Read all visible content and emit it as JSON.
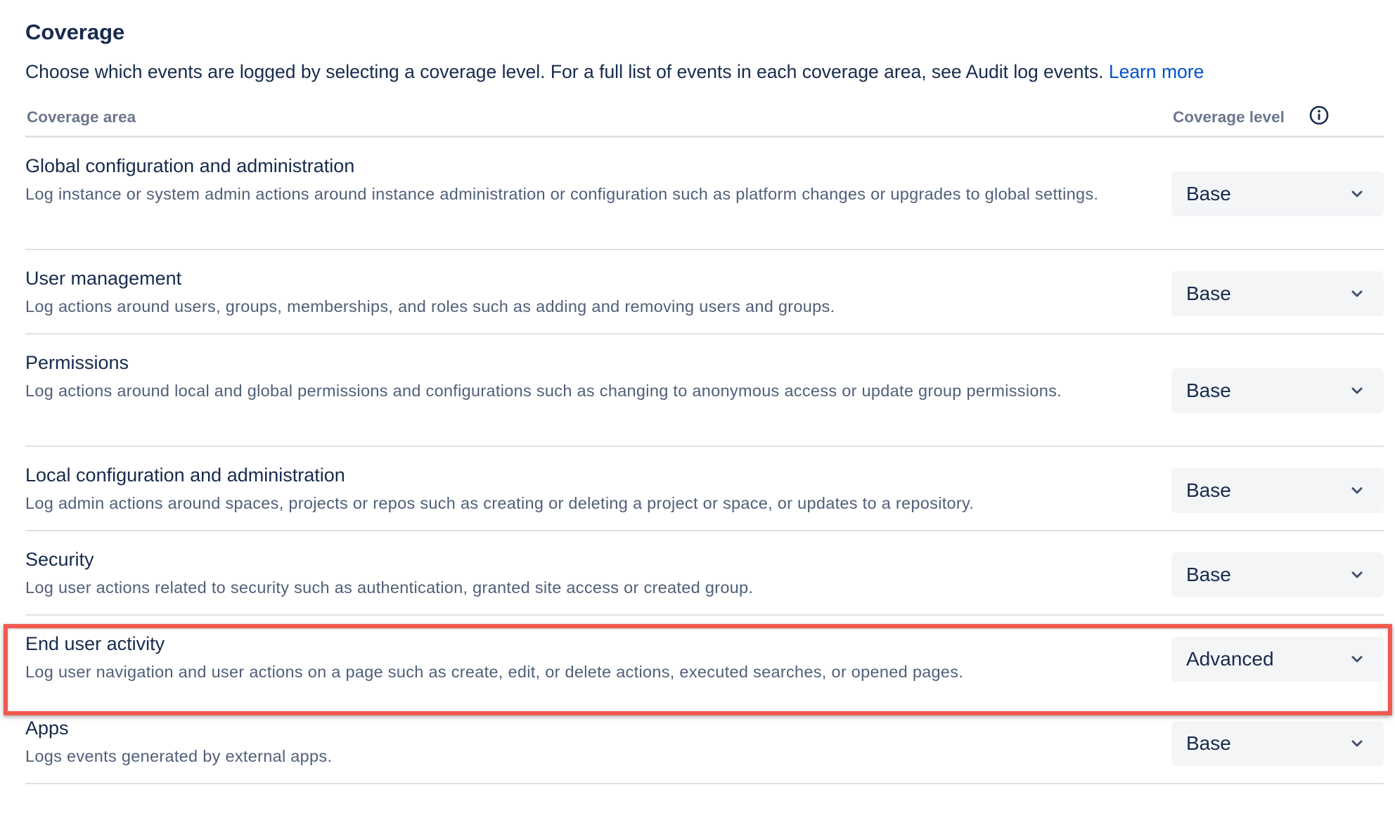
{
  "header": {
    "title": "Coverage",
    "intro_text": "Choose which events are logged by selecting a coverage level. For a full list of events in each coverage area, see Audit log events. ",
    "learn_more": "Learn more"
  },
  "table": {
    "col_area": "Coverage area",
    "col_level": "Coverage level",
    "info_icon": "info-icon",
    "rows": [
      {
        "title": "Global configuration and administration",
        "description": "Log instance or system admin actions around instance administration or configuration such as platform changes or upgrades to global settings.",
        "level": "Base"
      },
      {
        "title": "User management",
        "description": "Log actions around users, groups, memberships, and roles such as adding and removing users and groups.",
        "level": "Base"
      },
      {
        "title": "Permissions",
        "description": "Log actions around local and global permissions and configurations such as changing to anonymous access or update group permissions.",
        "level": "Base"
      },
      {
        "title": "Local configuration and administration",
        "description": "Log admin actions around spaces, projects or repos such as creating or deleting a project or space, or updates to a repository.",
        "level": "Base"
      },
      {
        "title": "Security",
        "description": "Log user actions related to security such as authentication, granted site access or created group.",
        "level": "Base"
      },
      {
        "title": "End user activity",
        "description": "Log user navigation and user actions on a page such as create, edit, or delete actions, executed searches, or opened pages.",
        "level": "Advanced"
      },
      {
        "title": "Apps",
        "description": "Logs events generated by external apps.",
        "level": "Base"
      }
    ]
  },
  "colors": {
    "text_primary": "#172b4d",
    "text_secondary": "#505f79",
    "link": "#0052cc",
    "highlight_border": "#f05a4f",
    "select_bg": "#f4f5f7"
  }
}
